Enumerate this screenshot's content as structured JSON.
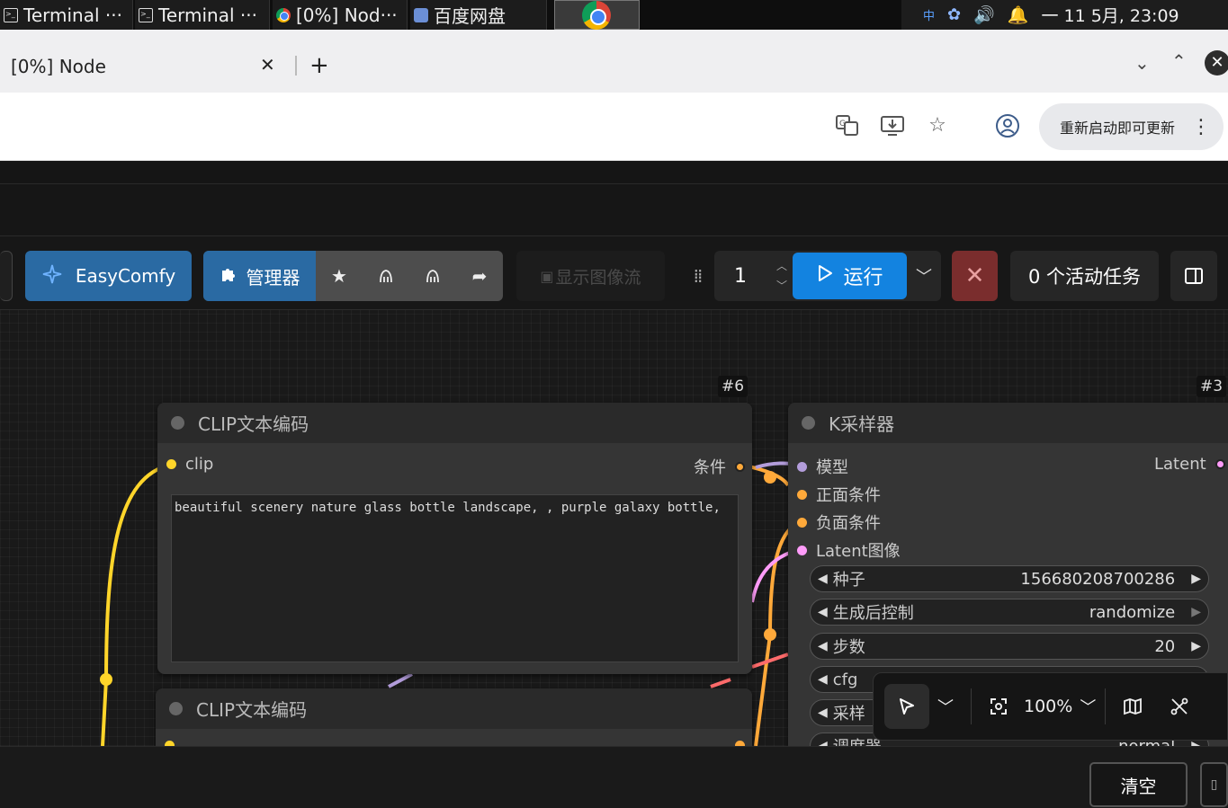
{
  "taskbar": {
    "tasks": [
      {
        "label": "Terminal ···",
        "icon": "terminal-icon"
      },
      {
        "label": "Terminal ···",
        "icon": "terminal-icon"
      },
      {
        "label": "[0%] Nod···",
        "icon": "chrome-icon"
      },
      {
        "label": "百度网盘",
        "icon": "baidu-netdisk-icon"
      }
    ],
    "tray": {
      "ime": "中",
      "clock": "一 11 5月, 23:09"
    }
  },
  "browser": {
    "tab_title": "[0%] Node",
    "tab_close": "✕",
    "new_tab": "+",
    "update_button": "重新启动即可更新"
  },
  "menubar": {
    "easycomfy": "EasyComfy",
    "manager": "管理器",
    "show_image_stream": "显示图像流",
    "queue_count": "1",
    "run": "运行",
    "cancel": "✕",
    "active_tasks": "0 个活动任务"
  },
  "nodes": {
    "clip1": {
      "id": "#6",
      "title": "CLIP文本编码",
      "input": "clip",
      "output": "条件",
      "prompt": "beautiful scenery nature glass bottle landscape, , purple galaxy bottle,"
    },
    "clip2": {
      "title": "CLIP文本编码"
    },
    "ksampler": {
      "id": "#3",
      "title": "K采样器",
      "inputs": [
        "模型",
        "正面条件",
        "负面条件",
        "Latent图像"
      ],
      "output": "Latent",
      "widgets": [
        {
          "label": "种子",
          "value": "156680208700286"
        },
        {
          "label": "生成后控制",
          "value": "randomize"
        },
        {
          "label": "步数",
          "value": "20"
        },
        {
          "label": "cfg",
          "value": ""
        },
        {
          "label": "采样",
          "value": ""
        },
        {
          "label": "调度器",
          "value": "normal"
        }
      ]
    }
  },
  "canvas_tools": {
    "zoom": "100%"
  },
  "bottom": {
    "clear": "清空"
  },
  "colors": {
    "accent_blue": "#1383e0",
    "manager_blue": "#2a6aa3",
    "cancel_red": "#7a2d2d",
    "clip_yellow": "#ffd52a",
    "cond_orange": "#ffa93a",
    "model_purple": "#b39ddb",
    "latent_pink": "#ff9cf9"
  }
}
